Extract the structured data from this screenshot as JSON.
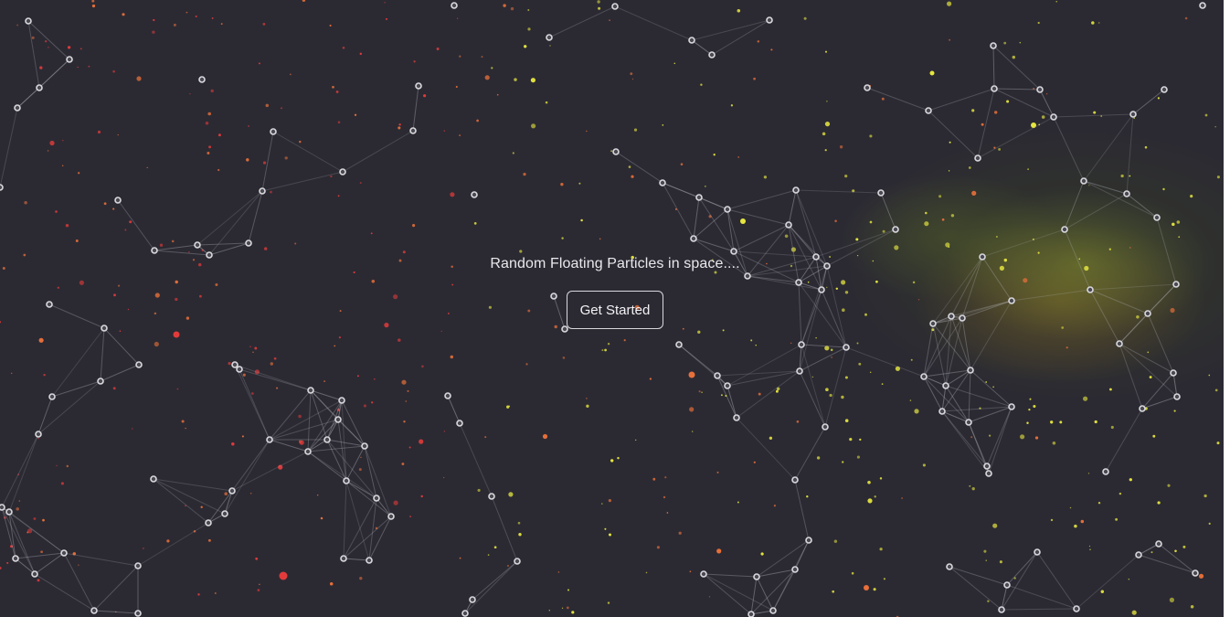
{
  "hero": {
    "tagline": "Random Floating Particles in space....",
    "cta_label": "Get Started"
  },
  "colors": {
    "background": "#2b2a33",
    "node": "#d9d9de",
    "link": "#b8b8c0",
    "dust_warm": "#e8703a",
    "dust_red": "#e23b3b",
    "dust_yellow": "#e6e640",
    "nebula_green": "#8a9a2e",
    "nebula_orange": "#c8862e"
  }
}
